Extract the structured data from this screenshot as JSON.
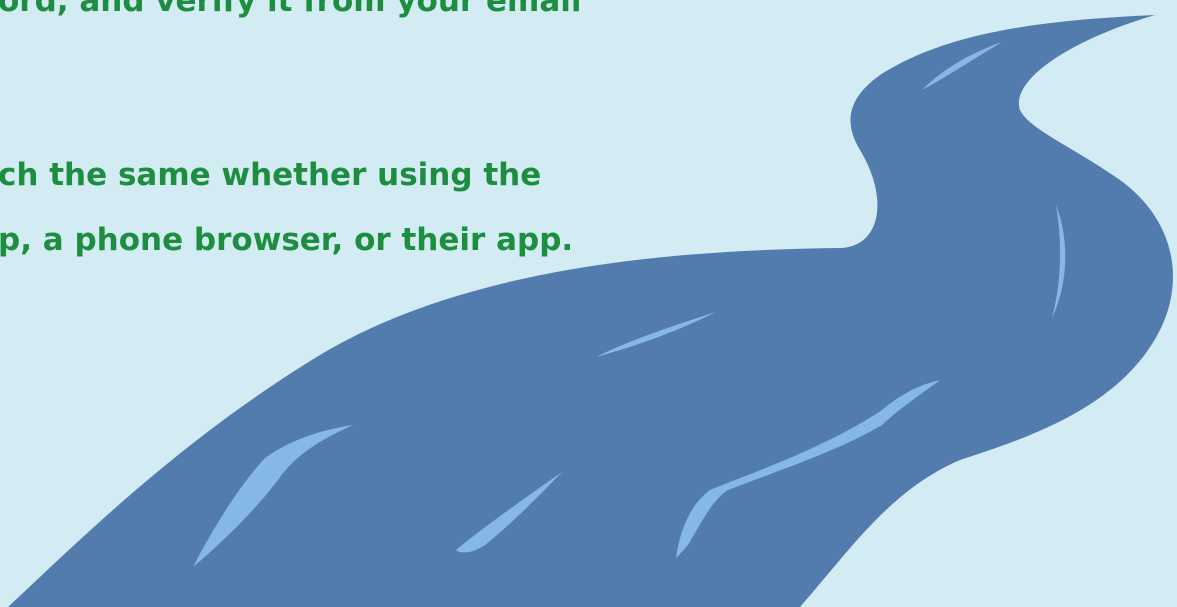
{
  "theme": {
    "background": "#d3ebf3",
    "text_color": "#1d8e3f",
    "river_color": "#537cae",
    "highlight_color": "#86b8e6"
  },
  "decor": {
    "river_icon": "winding-river-illustration"
  },
  "content": {
    "lines": [
      "ord, and verify it from your email",
      "ch the same whether using the",
      "p, a phone browser, or their app."
    ]
  }
}
